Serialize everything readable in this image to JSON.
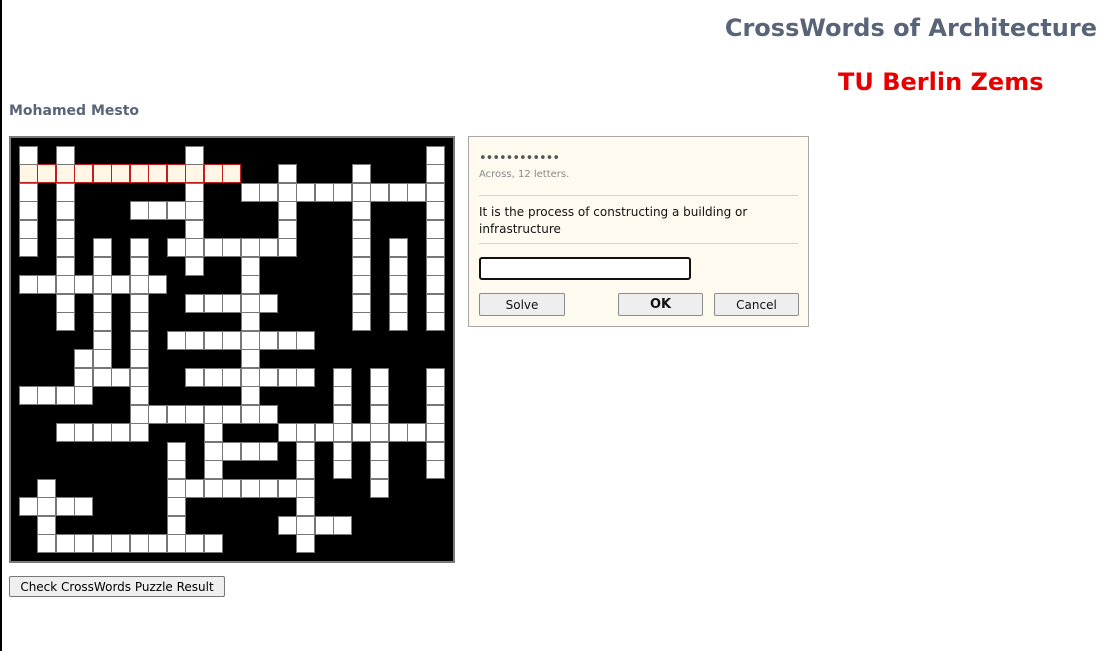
{
  "header": {
    "app_title": "CrossWords of Architecture",
    "sub_title": "TU Berlin Zems",
    "author": "Mohamed Mesto"
  },
  "dialog": {
    "answer_mask": "••••••••••••",
    "clue_meta": "Across, 12 letters.",
    "clue_text": "It is the process of constructing a building or infrastructure",
    "answer_value": "",
    "solve_label": "Solve",
    "ok_label": "OK",
    "cancel_label": "Cancel"
  },
  "footer": {
    "check_label": "Check CrossWords Puzzle Result"
  },
  "colors": {
    "title": "#5a6478",
    "subtitle": "#e60000",
    "active_border": "#c31c1c",
    "board_bg": "#000000"
  }
}
